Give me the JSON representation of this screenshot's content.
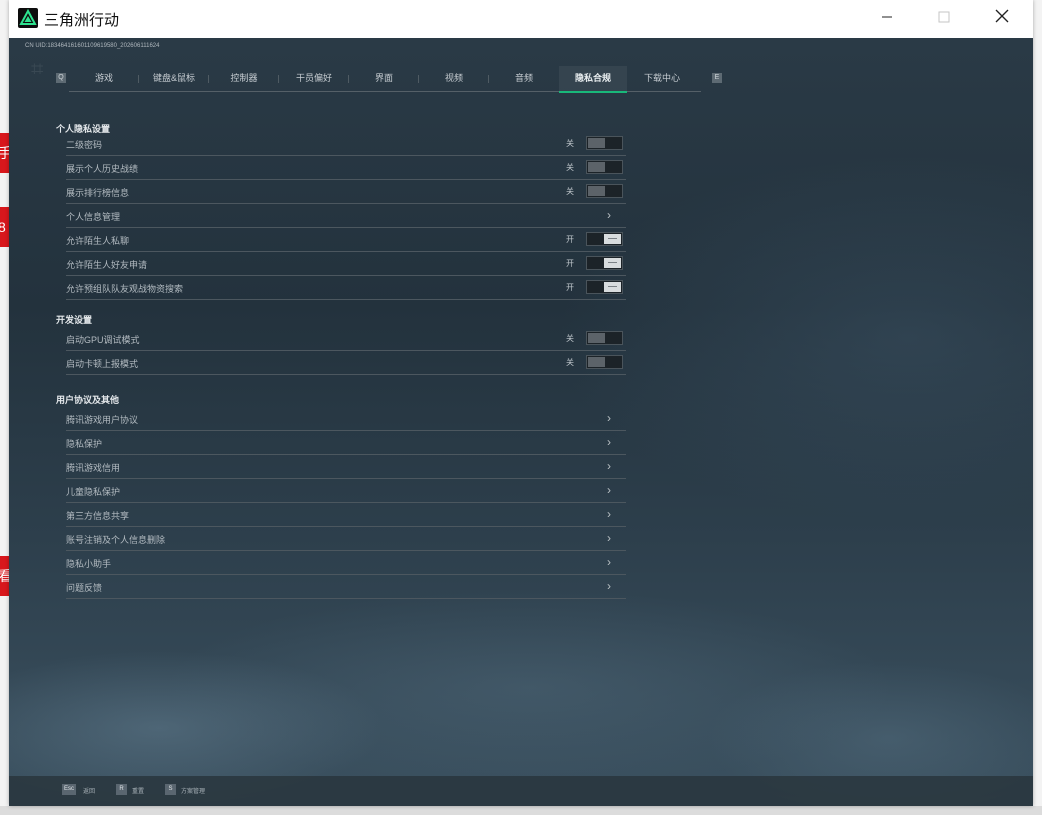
{
  "window": {
    "title": "三角洲行动"
  },
  "build_id": "CN UID:183464161601109619580_202606111624",
  "tabs": [
    "游戏",
    "键盘&鼠标",
    "控制器",
    "干员偏好",
    "界面",
    "视频",
    "音频",
    "隐私合规",
    "下载中心"
  ],
  "active_tab": "隐私合规",
  "tab_prev_key": "Q",
  "tab_next_key": "E",
  "sections": {
    "personal": {
      "title": "个人隐私设置",
      "rows": [
        {
          "label": "二级密码",
          "state": "关",
          "type": "toggle-off"
        },
        {
          "label": "展示个人历史战绩",
          "state": "关",
          "type": "toggle-off"
        },
        {
          "label": "展示排行榜信息",
          "state": "关",
          "type": "toggle-off"
        },
        {
          "label": "个人信息管理",
          "type": "link"
        },
        {
          "label": "允许陌生人私聊",
          "state": "开",
          "type": "toggle-on"
        },
        {
          "label": "允许陌生人好友申请",
          "state": "开",
          "type": "toggle-on"
        },
        {
          "label": "允许预组队队友观战物资搜索",
          "state": "开",
          "type": "toggle-on"
        }
      ]
    },
    "developer": {
      "title": "开发设置",
      "rows": [
        {
          "label": "启动GPU调试模式",
          "state": "关",
          "type": "toggle-off"
        },
        {
          "label": "启动卡顿上报模式",
          "state": "关",
          "type": "toggle-off"
        }
      ]
    },
    "agreements": {
      "title": "用户协议及其他",
      "rows": [
        {
          "label": "腾讯游戏用户协议",
          "type": "link"
        },
        {
          "label": "隐私保护",
          "type": "link"
        },
        {
          "label": "腾讯游戏信用",
          "type": "link"
        },
        {
          "label": "儿童隐私保护",
          "type": "link"
        },
        {
          "label": "第三方信息共享",
          "type": "link"
        },
        {
          "label": "账号注销及个人信息删除",
          "type": "link"
        },
        {
          "label": "隐私小助手",
          "type": "link"
        },
        {
          "label": "问题反馈",
          "type": "link"
        }
      ]
    }
  },
  "footer": [
    {
      "key": "Esc",
      "label": "返回"
    },
    {
      "key": "R",
      "label": "重置"
    },
    {
      "key": "S",
      "label": "方案管理"
    }
  ],
  "icons": {
    "chevron": "chevron-right-icon",
    "logo": "delta-force-logo"
  },
  "colors": {
    "accent": "#19b87a",
    "title_bar": "#ffffff"
  }
}
